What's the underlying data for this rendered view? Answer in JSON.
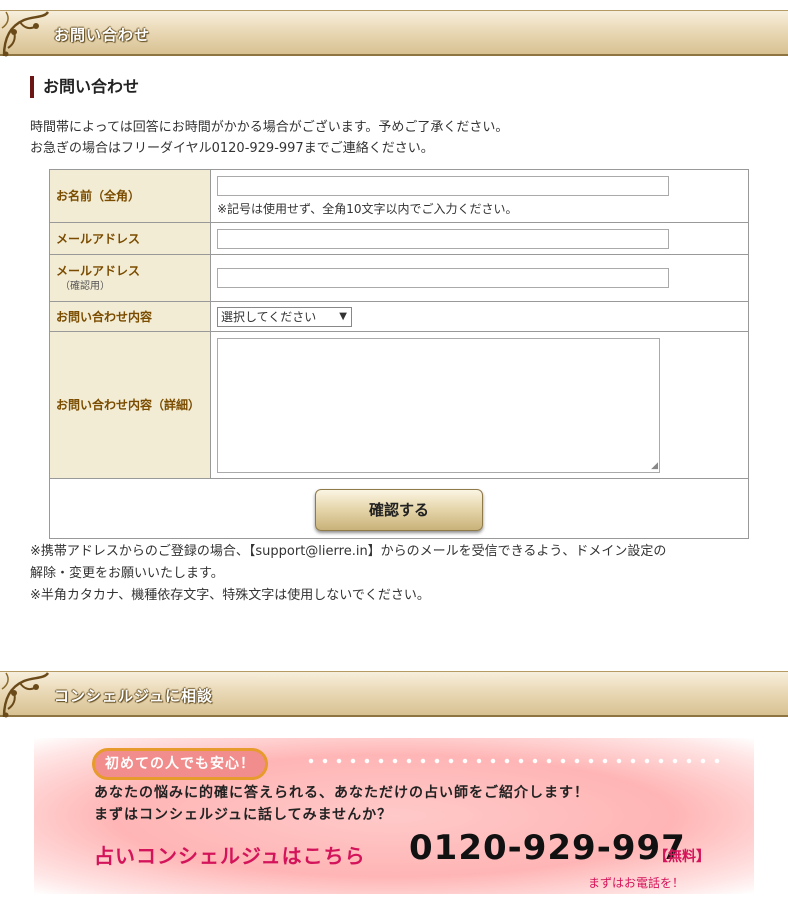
{
  "contact_header": {
    "title": "お問い合わせ"
  },
  "section": {
    "title": "お問い合わせ"
  },
  "intro": {
    "line1": "時間帯によっては回答にお時間がかかる場合がございます。予めご了承ください。",
    "line2": "お急ぎの場合はフリーダイヤル0120-929-997までご連絡ください。"
  },
  "form": {
    "name_label": "お名前（全角）",
    "name_value": "",
    "name_note": "※記号は使用せず、全角10文字以内でご入力ください。",
    "email_label": "メールアドレス",
    "email_value": "",
    "email_confirm_label": "メールアドレス",
    "email_confirm_sub": "（確認用）",
    "email_confirm_value": "",
    "inquiry_type_label": "お問い合わせ内容",
    "inquiry_type_selected": "選択してください",
    "inquiry_detail_label": "お問い合わせ内容（詳細）",
    "inquiry_detail_value": "",
    "submit_label": "確認する"
  },
  "footnotes": {
    "line1": "※携帯アドレスからのご登録の場合、【support@lierre.in】からのメールを受信できるよう、ドメイン設定の",
    "line2": "解除・変更をお願いいたします。",
    "line3": "※半角カタカナ、機種依存文字、特殊文字は使用しないでください。"
  },
  "concierge_header": {
    "title": "コンシェルジュに相談"
  },
  "promo": {
    "badge": "初めての人でも安心！",
    "line1": "あなたの悩みに的確に答えられる、あなただけの占い師をご紹介します！",
    "line2": "まずはコンシェルジュに話してみませんか？",
    "cta": "占いコンシェルジュはこちら",
    "phone": "0120-929-997",
    "free": "【無料】",
    "call": "まずはお電話を！"
  },
  "colors": {
    "accent": "#6b1515",
    "label_bg": "#f3ecd4",
    "label_text": "#7a4c00",
    "promo_pink": "#d4145a"
  },
  "icons": {
    "header_ornament": "ornament-icon",
    "select_arrow": "chevron-down-icon"
  }
}
